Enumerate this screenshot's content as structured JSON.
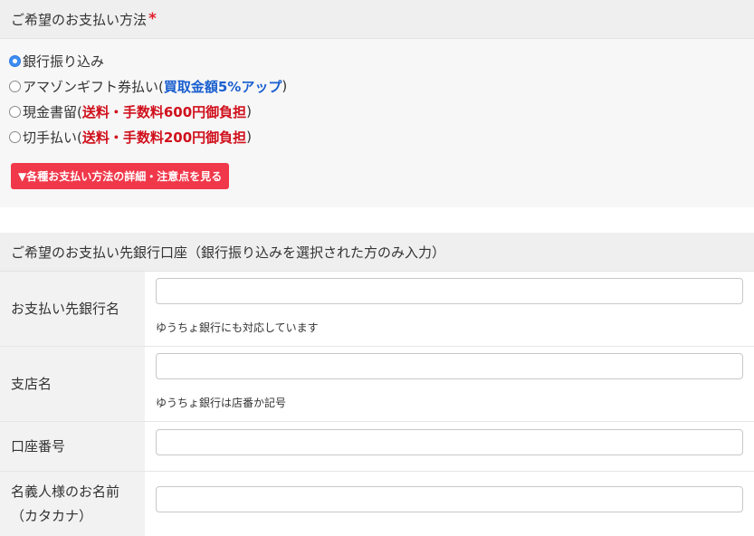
{
  "payment_method": {
    "header": "ご希望のお支払い方法",
    "required_mark": "*",
    "options": [
      {
        "label": "銀行振り込み",
        "note": "",
        "note_color": "",
        "checked": true
      },
      {
        "label": "アマゾンギフト券払い(",
        "note": "買取金額5%アップ",
        "note_suffix": ")",
        "note_color": "#1a5fcf",
        "checked": false
      },
      {
        "label": "現金書留(",
        "note": "送料・手数料600円御負担",
        "note_suffix": ")",
        "note_color": "#d0101c",
        "checked": false
      },
      {
        "label": "切手払い(",
        "note": "送料・手数料200円御負担",
        "note_suffix": ")",
        "note_color": "#d0101c",
        "checked": false
      }
    ],
    "detail_button": "▼各種お支払い方法の詳細・注意点を見る",
    "accent_color": "#f0384a"
  },
  "bank_account": {
    "header": "ご希望のお支払い先銀行口座（銀行振り込みを選択された方のみ入力）",
    "fields": [
      {
        "label": "お支払い先銀行名",
        "value": "",
        "help": "ゆうちょ銀行にも対応しています"
      },
      {
        "label": "支店名",
        "value": "",
        "help": "ゆうちょ銀行は店番か記号"
      },
      {
        "label": "口座番号",
        "value": "",
        "help": ""
      },
      {
        "label_line1": "名義人様のお名前",
        "label_line2": "（カタカナ）",
        "value": "",
        "help": ""
      }
    ]
  }
}
